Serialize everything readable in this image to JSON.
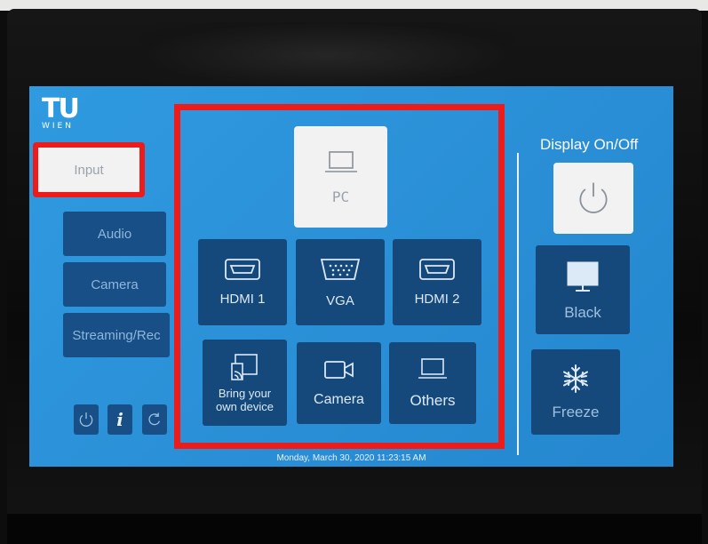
{
  "logo": {
    "line1": "TU",
    "line2": "WIEN"
  },
  "nav": {
    "items": [
      {
        "label": "Input",
        "active": true
      },
      {
        "label": "Audio",
        "active": false
      },
      {
        "label": "Camera",
        "active": false
      },
      {
        "label": "Streaming/Rec",
        "active": false
      }
    ]
  },
  "utility": {
    "power_icon": "power-icon",
    "info_label": "i",
    "reset_icon": "refresh-icon"
  },
  "sources": {
    "pc": {
      "label": "PC",
      "icon": "laptop-icon"
    },
    "tiles": [
      {
        "label": "HDMI 1",
        "icon": "hdmi-icon"
      },
      {
        "label": "VGA",
        "icon": "vga-icon"
      },
      {
        "label": "HDMI 2",
        "icon": "hdmi-icon"
      },
      {
        "label": "Bring your own device",
        "icon": "wireless-device-icon"
      },
      {
        "label": "Camera",
        "icon": "video-camera-icon"
      },
      {
        "label": "Others",
        "icon": "laptop-icon"
      }
    ]
  },
  "display": {
    "title": "Display On/Off",
    "power_icon": "power-icon",
    "black_label": "Black",
    "freeze_label": "Freeze"
  },
  "status": {
    "datetime": "Monday, March 30, 2020 11:23:15 AM"
  },
  "colors": {
    "screen_bg": "#2a8fd6",
    "tile_bg": "#15497b",
    "highlight": "#ee1b1b",
    "selected_bg": "#f2f2f2"
  }
}
